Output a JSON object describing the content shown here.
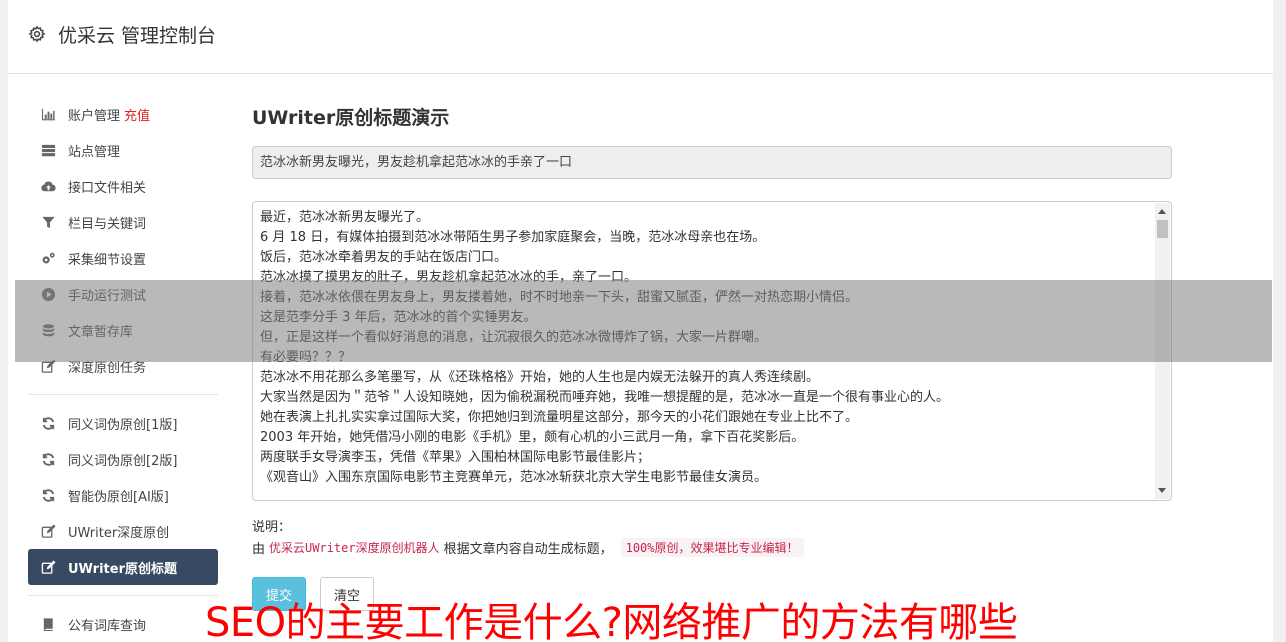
{
  "header": {
    "brand": "优采云 管理控制台",
    "icon": "gear-icon"
  },
  "sidebar": {
    "group1": [
      {
        "label": "账户管理",
        "badge": "充值",
        "icon": "bar-chart-icon"
      },
      {
        "label": "站点管理",
        "icon": "server-icon"
      },
      {
        "label": "接口文件相关",
        "icon": "cloud-upload-icon"
      },
      {
        "label": "栏目与关键词",
        "icon": "filter-icon"
      },
      {
        "label": "采集细节设置",
        "icon": "gears-icon"
      },
      {
        "label": "手动运行测试",
        "icon": "play-circle-icon"
      },
      {
        "label": "文章暂存库",
        "icon": "database-icon"
      },
      {
        "label": "深度原创任务",
        "icon": "edit-icon"
      }
    ],
    "group2": [
      {
        "label": "同义词伪原创[1版]",
        "icon": "refresh-icon"
      },
      {
        "label": "同义词伪原创[2版]",
        "icon": "refresh-icon"
      },
      {
        "label": "智能伪原创[AI版]",
        "icon": "refresh-icon"
      },
      {
        "label": "UWriter深度原创",
        "icon": "edit-icon"
      },
      {
        "label": "UWriter原创标题",
        "icon": "edit-icon",
        "active": true
      }
    ],
    "group3": [
      {
        "label": "公有词库查询",
        "icon": "book-icon"
      }
    ]
  },
  "main": {
    "title": "UWriter原创标题演示",
    "generated_title": "范冰冰新男友曝光，男友趁机拿起范冰冰的手亲了一口",
    "article_lines": [
      "最近，范冰冰新男友曝光了。",
      "6 月 18 日，有媒体拍摄到范冰冰带陌生男子参加家庭聚会，当晚，范冰冰母亲也在场。",
      "饭后，范冰冰牵着男友的手站在饭店门口。",
      "范冰冰摸了摸男友的肚子，男友趁机拿起范冰冰的手，亲了一口。",
      "接着，范冰冰依偎在男友身上，男友搂着她，时不时地亲一下头，甜蜜又腻歪，俨然一对热恋期小情侣。",
      "这是范李分手 3 年后，范冰冰的首个实锤男友。",
      "但，正是这样一个看似好消息的消息，让沉寂很久的范冰冰微博炸了锅，大家一片群嘲。",
      "有必要吗？？？",
      "范冰冰不用花那么多笔墨写，从《还珠格格》开始，她的人生也是内娱无法躲开的真人秀连续剧。",
      "大家当然是因为＂范爷＂人设知晓她，因为偷税漏税而唾弃她，我唯一想提醒的是，范冰冰一直是一个很有事业心的人。",
      "她在表演上扎扎实实拿过国际大奖，你把她归到流量明星这部分，那今天的小花们跟她在专业上比不了。",
      "2003 年开始，她凭借冯小刚的电影《手机》里，颇有心机的小三武月一角，拿下百花奖影后。",
      "两度联手女导演李玉，凭借《苹果》入围柏林国际电影节最佳影片；",
      "《观音山》入围东京国际电影节主竞赛单元，范冰冰斩获北京大学生电影节最佳女演员。"
    ],
    "note_label": "说明：",
    "note_prefix": "由",
    "note_tag": "优采云UWriter深度原创机器人",
    "note_middle": "根据文章内容自动生成标题，",
    "note_highlight": "100%原创，效果堪比专业编辑！",
    "submit_label": "提交",
    "clear_label": "清空"
  },
  "caption": "SEO的主要工作是什么?网络推广的方法有哪些",
  "colors": {
    "active_nav_bg": "#374a62",
    "submit_bg": "#5bc0de",
    "caption": "#ff0000",
    "recharge": "#d9261c"
  }
}
